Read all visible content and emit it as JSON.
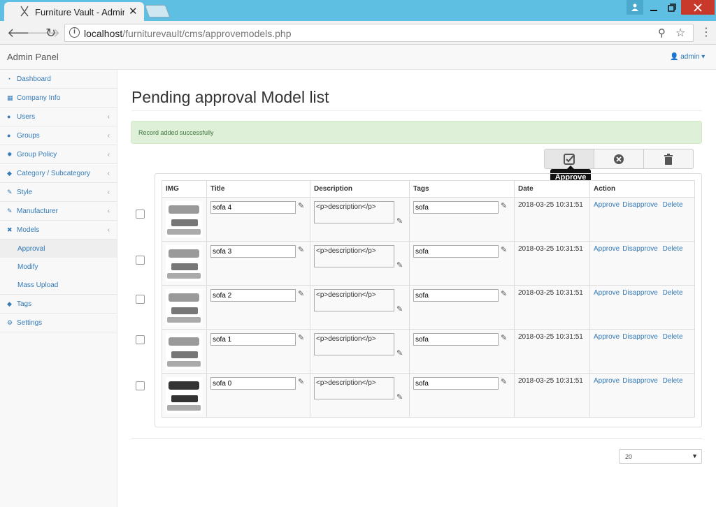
{
  "browser": {
    "tab_title": "Furniture Vault - Admin P",
    "close_glyph": "✕",
    "url_host": "localhost",
    "url_path": "/furniturevault/cms/approvemodels.php"
  },
  "header": {
    "brand": "Admin Panel",
    "user": "admin"
  },
  "sidebar": {
    "items": [
      {
        "label": "Dashboard",
        "icon": "dashboard-icon",
        "glyph": "◔",
        "arrow": ""
      },
      {
        "label": "Company Info",
        "icon": "building-icon",
        "glyph": "▦",
        "arrow": ""
      },
      {
        "label": "Users",
        "icon": "users-icon",
        "glyph": "●",
        "arrow": "‹"
      },
      {
        "label": "Groups",
        "icon": "groups-icon",
        "glyph": "●",
        "arrow": "‹"
      },
      {
        "label": "Group Policy",
        "icon": "policy-icon",
        "glyph": "✹",
        "arrow": "‹"
      },
      {
        "label": "Category / Subcategory",
        "icon": "tag-icon",
        "glyph": "◆",
        "arrow": "‹"
      },
      {
        "label": "Style",
        "icon": "wrench-icon",
        "glyph": "✎",
        "arrow": "‹"
      },
      {
        "label": "Manufacturer",
        "icon": "wrench-icon",
        "glyph": "✎",
        "arrow": "‹"
      },
      {
        "label": "Models",
        "icon": "models-icon",
        "glyph": "✖",
        "arrow": "‹"
      }
    ],
    "models_sub": [
      "Approval",
      "Modify",
      "Mass Upload"
    ],
    "items_after": [
      {
        "label": "Tags",
        "icon": "tags-icon",
        "glyph": "◆"
      },
      {
        "label": "Settings",
        "icon": "settings-icon",
        "glyph": "⚙"
      }
    ]
  },
  "main": {
    "title": "Pending approval Model list",
    "alert": "Record added successfully",
    "tooltip": "Approve",
    "columns": [
      "IMG",
      "Title",
      "Description",
      "Tags",
      "Date",
      "Action"
    ],
    "rows": [
      {
        "title": "sofa 4",
        "description": "<p>description</p>",
        "tags": "sofa",
        "date": "2018-03-25 10:31:51"
      },
      {
        "title": "sofa 3",
        "description": "<p>description</p>",
        "tags": "sofa",
        "date": "2018-03-25 10:31:51"
      },
      {
        "title": "sofa 2",
        "description": "<p>description</p>",
        "tags": "sofa",
        "date": "2018-03-25 10:31:51"
      },
      {
        "title": "sofa 1",
        "description": "<p>description</p>",
        "tags": "sofa",
        "date": "2018-03-25 10:31:51"
      },
      {
        "title": "sofa 0",
        "description": "<p>description</p>",
        "tags": "sofa",
        "date": "2018-03-25 10:31:51"
      }
    ],
    "row_actions": [
      "Approve",
      "Disapprove",
      "Delete"
    ],
    "page_size": "20"
  }
}
